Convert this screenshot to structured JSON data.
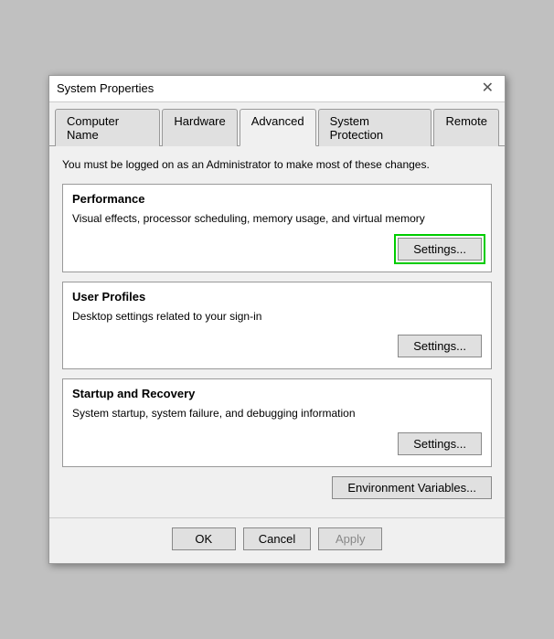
{
  "window": {
    "title": "System Properties",
    "close_label": "✕"
  },
  "tabs": [
    {
      "label": "Computer Name",
      "active": false
    },
    {
      "label": "Hardware",
      "active": false
    },
    {
      "label": "Advanced",
      "active": true
    },
    {
      "label": "System Protection",
      "active": false
    },
    {
      "label": "Remote",
      "active": false
    }
  ],
  "admin_notice": "You must be logged on as an Administrator to make most of these changes.",
  "sections": [
    {
      "id": "performance",
      "title": "Performance",
      "desc": "Visual effects, processor scheduling, memory usage, and virtual memory",
      "btn_label": "Settings...",
      "highlighted": true
    },
    {
      "id": "user_profiles",
      "title": "User Profiles",
      "desc": "Desktop settings related to your sign-in",
      "btn_label": "Settings...",
      "highlighted": false
    },
    {
      "id": "startup_recovery",
      "title": "Startup and Recovery",
      "desc": "System startup, system failure, and debugging information",
      "btn_label": "Settings...",
      "highlighted": false
    }
  ],
  "env_btn_label": "Environment Variables...",
  "footer": {
    "ok": "OK",
    "cancel": "Cancel",
    "apply": "Apply"
  }
}
